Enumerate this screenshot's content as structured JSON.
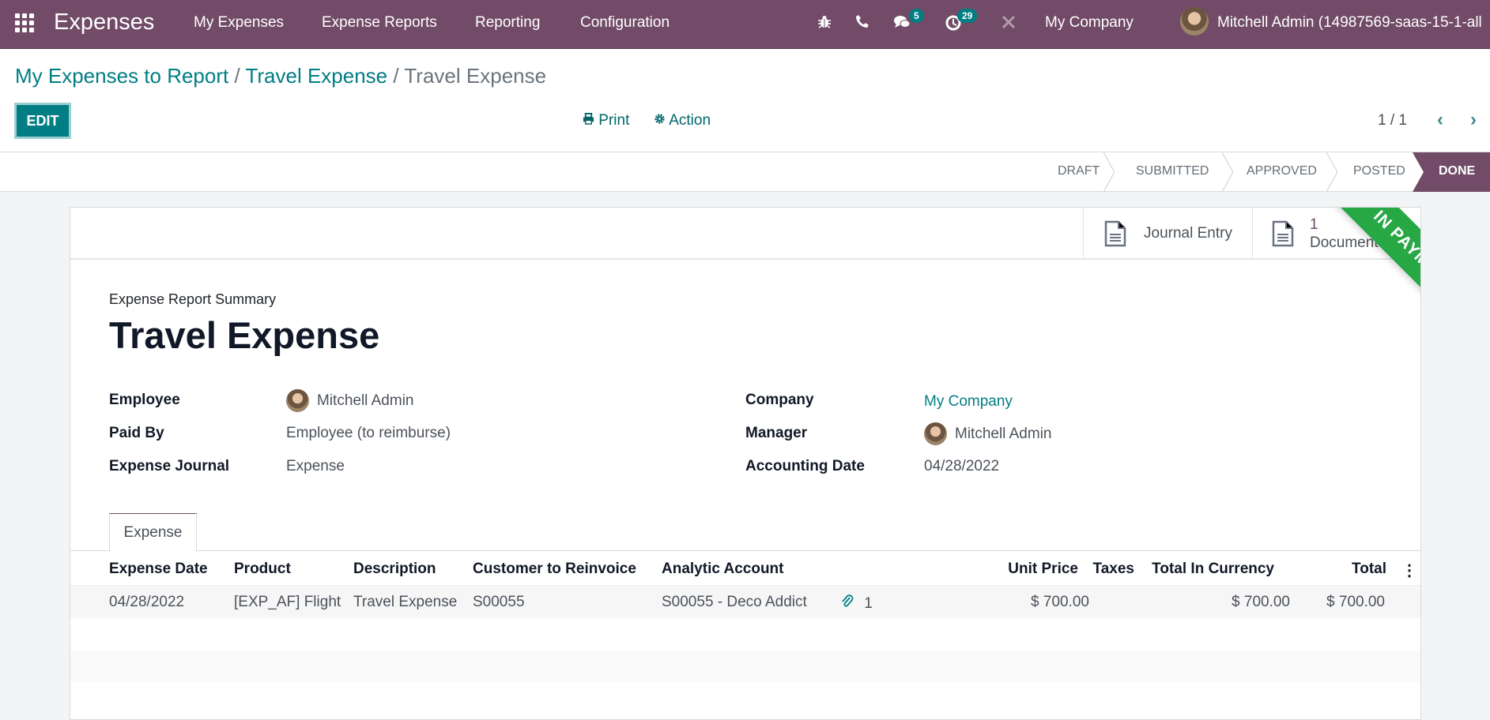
{
  "topbar": {
    "app_name": "Expenses",
    "menu": [
      "My Expenses",
      "Expense Reports",
      "Reporting",
      "Configuration"
    ],
    "icons": [
      "bug-icon",
      "phone-icon",
      "chat-icon",
      "activity-clock-icon",
      "tools-icon"
    ],
    "messages_badge": "5",
    "activities_badge": "29",
    "company": "My Company",
    "user": "Mitchell Admin (14987569-saas-15-1-all"
  },
  "breadcrumb": {
    "items": [
      "My Expenses to Report",
      "Travel Expense"
    ],
    "current": "Travel Expense",
    "separator": "/"
  },
  "toolbar": {
    "edit_label": "EDIT",
    "print_label": "Print",
    "action_label": "Action",
    "pager": "1 / 1"
  },
  "statusbar": {
    "stages": [
      "DRAFT",
      "SUBMITTED",
      "APPROVED",
      "POSTED"
    ],
    "current": "DONE"
  },
  "smart_buttons": {
    "journal_entry": "Journal Entry",
    "documents_count": "1",
    "documents_label": "Documents"
  },
  "ribbon": {
    "text": "IN PAYMENT",
    "color": "#28a745"
  },
  "form": {
    "subtitle": "Expense Report Summary",
    "title": "Travel Expense",
    "left": [
      {
        "label": "Employee",
        "value": "Mitchell Admin"
      },
      {
        "label": "Paid By",
        "value": "Employee (to reimburse)"
      },
      {
        "label": "Expense Journal",
        "value": "Expense"
      }
    ],
    "right": [
      {
        "label": "Company",
        "value": "My Company"
      },
      {
        "label": "Manager",
        "value": "Mitchell Admin"
      },
      {
        "label": "Accounting Date",
        "value": "04/28/2022"
      }
    ]
  },
  "tabs": [
    "Expense"
  ],
  "table": {
    "columns": [
      "Expense Date",
      "Product",
      "Description",
      "Customer to Reinvoice",
      "Analytic Account",
      "Unit Price",
      "Taxes",
      "Total In Currency",
      "Total"
    ],
    "rows": [
      {
        "date": "04/28/2022",
        "product": "[EXP_AF] Flight",
        "description": "Travel Expense",
        "customer": "S00055",
        "analytic": "S00055 - Deco Addict",
        "attachments": "1",
        "unit_price": "$ 700.00",
        "taxes": "",
        "total_currency": "$ 700.00",
        "total": "$ 700.00"
      }
    ]
  },
  "colors": {
    "brand": "#714b67",
    "accent": "#017e84"
  }
}
